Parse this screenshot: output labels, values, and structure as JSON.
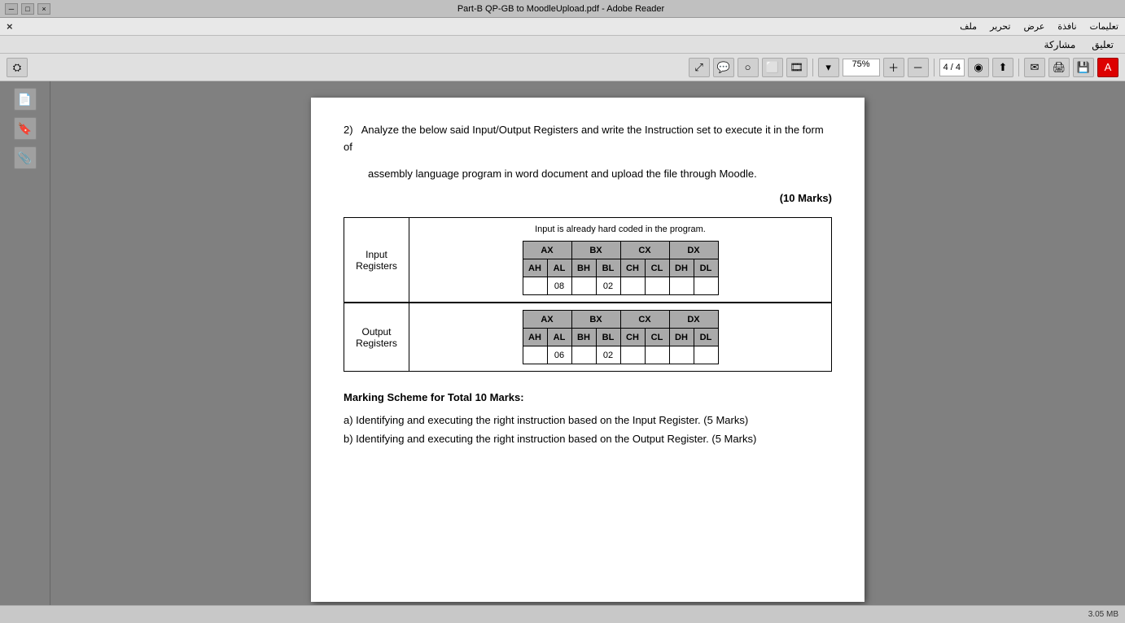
{
  "titlebar": {
    "title": "Part-B QP-GB to MoodleUpload.pdf - Adobe Reader",
    "btns": [
      "×",
      "□",
      "─"
    ]
  },
  "menubar": {
    "items": [
      "تعليمات",
      "نافذة",
      "عرض",
      "تحرير",
      "ملف"
    ],
    "close": "×"
  },
  "tabbar": {
    "tabs": [
      "تعليق",
      "مشاركة"
    ]
  },
  "toolbar": {
    "zoom": "75%",
    "page_current": "4",
    "page_total": "4"
  },
  "question": {
    "number": "2)",
    "text": "Analyze the below said Input/Output Registers and write the Instruction set to execute it in the form of",
    "text2": "assembly language program in word document and upload the file through Moodle.",
    "marks": "(10 Marks)"
  },
  "input_table": {
    "label_line1": "Input",
    "label_line2": "Registers",
    "note": "Input is already hard coded in the program.",
    "headers_16bit": [
      "AX",
      "BX",
      "CX",
      "DX"
    ],
    "headers_8bit": [
      "AH",
      "AL",
      "BH",
      "BL",
      "CH",
      "CL",
      "DH",
      "DL"
    ],
    "data": [
      "",
      "08",
      "",
      "02",
      "",
      "",
      "",
      ""
    ]
  },
  "output_table": {
    "label_line1": "Output",
    "label_line2": "Registers",
    "headers_16bit": [
      "AX",
      "BX",
      "CX",
      "DX"
    ],
    "headers_8bit": [
      "AH",
      "AL",
      "BH",
      "BL",
      "CH",
      "CL",
      "DH",
      "DL"
    ],
    "data": [
      "",
      "06",
      "",
      "02",
      "",
      "",
      "",
      ""
    ]
  },
  "marking": {
    "title": "Marking Scheme for Total 10 Marks:",
    "point_a": "a) Identifying and executing the right instruction based on the Input Register. (5 Marks)",
    "point_b": "b) Identifying and executing the right instruction based on the Output Register. (5 Marks)"
  },
  "statusbar": {
    "text": "3.05 MB"
  }
}
